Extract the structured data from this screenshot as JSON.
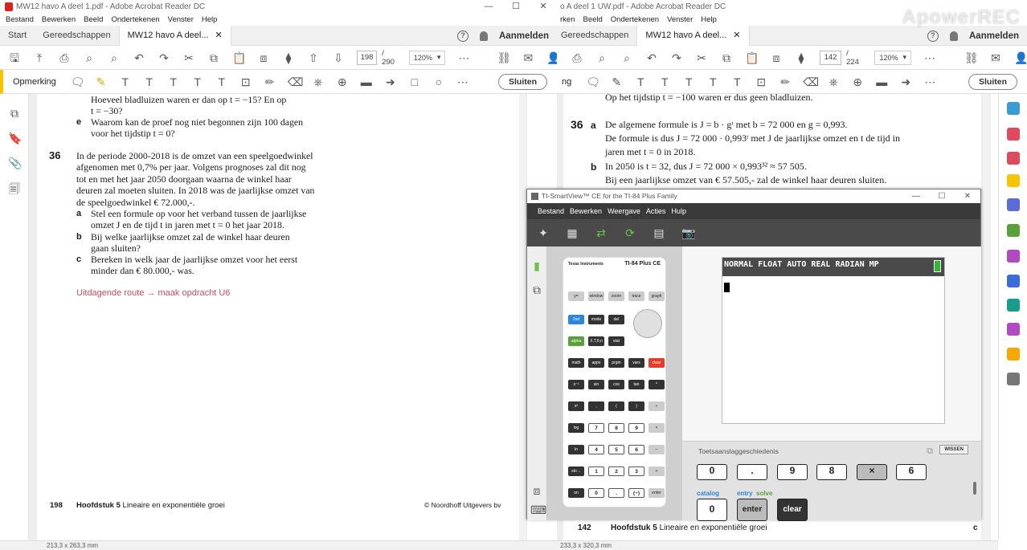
{
  "left_window": {
    "title": "MW12 havo A deel 1.pdf - Adobe Acrobat Reader DC",
    "menu": [
      "Bestand",
      "Bewerken",
      "Beeld",
      "Ondertekenen",
      "Venster",
      "Help"
    ],
    "tabs": {
      "start": "Start",
      "tools": "Gereedschappen",
      "doc": "MW12 havo A deel..."
    },
    "signin": "Aanmelden",
    "page_current": "198",
    "page_total": "/ 290",
    "zoom": "120%",
    "annotation_label": "Opmerking",
    "close_label": "Sluiten",
    "status": "213,3 x 263,3 mm",
    "page": {
      "lines_top": [
        "Hoeveel bladluizen waren er dan op t = −15? En op",
        "t = −30?"
      ],
      "e_label": "e",
      "e_lines": [
        "Waarom kan de proef nog niet begonnen zijn 100 dagen",
        "voor het tijdstip t = 0?"
      ],
      "q_number": "36",
      "q_lines": [
        "In de periode 2000-2018 is de omzet van een speelgoedwinkel",
        "afgenomen met 0,7% per jaar. Volgens prognoses zal dit nog",
        "tot en met het jaar 2050 doorgaan waarna de winkel haar",
        "deuren zal moeten sluiten. In 2018 was de jaarlijkse omzet van",
        "de speelgoedwinkel € 72.000,-."
      ],
      "a_label": "a",
      "a_lines": [
        "Stel een formule op voor het verband tussen de jaarlijkse",
        "omzet J en de tijd t in jaren met t = 0 het jaar 2018."
      ],
      "b_label": "b",
      "b_lines": [
        "Bij welke jaarlijkse omzet zal de winkel haar deuren",
        "gaan sluiten?"
      ],
      "c_label": "c",
      "c_lines": [
        "Bereken in welk jaar de jaarlijkse omzet voor het eerst",
        "minder dan € 80.000,- was."
      ],
      "route": "Uitdagende route → maak opdracht U6",
      "footer_page": "198",
      "footer_chapter_bold": "Hoofdstuk 5",
      "footer_chapter": "Lineaire en exponentiële groei",
      "footer_publisher": "© Noordhoff Uitgevers bv"
    }
  },
  "right_window": {
    "title": "o A deel 1 UW.pdf - Adobe Acrobat Reader DC",
    "menu": [
      "rken",
      "Beeld",
      "Ondertekenen",
      "Venster",
      "Help"
    ],
    "tab_tools": "Gereedschappen",
    "tab_doc": "MW12 havo A deel...",
    "signin": "Aanmelden",
    "page_current": "142",
    "page_total": "/ 224",
    "zoom": "120%",
    "annotation_label": "ng",
    "close_label": "Sluiten",
    "status": "233,3 x 320,3 mm",
    "page": {
      "top_line": "Op het tijdstip t = −100 waren er dus geen bladluizen.",
      "q_number": "36",
      "a_label": "a",
      "a_lines": [
        "De algemene formule is J = b · gᵗ met b = 72 000 en g = 0,993.",
        "De formule is dus J = 72 000 · 0,993ᵗ met J de jaarlijkse omzet en t de tijd in",
        "jaren met t = 0 in 2018."
      ],
      "b_label": "b",
      "b_lines": [
        "In 2050 is t = 32, dus J = 72 000 × 0,993³² ≈ 57 505.",
        "Bij een jaarlijkse omzet van € 57.505,- zal de winkel haar deuren sluiten."
      ],
      "footer_page": "142",
      "footer_chapter_bold": "Hoofdstuk 5",
      "footer_chapter": "Lineaire en exponentiële groei",
      "footer_right": "c"
    }
  },
  "ti_window": {
    "title": "TI-SmartView™ CE for the TI-84 Plus Family",
    "menu": [
      "Bestand",
      "Bewerken",
      "Weergave",
      "Acties",
      "Hulp"
    ],
    "calc_brand": "Texas Instruments",
    "calc_model": "TI-84 Plus CE",
    "lcd_status": "NORMAL FLOAT AUTO REAL RADIAN MP",
    "history_title": "Toetsaanslaggeschiedenis",
    "history_clear": "WISSEN",
    "history_row1": [
      "0",
      ".",
      "9",
      "8",
      "×",
      "6"
    ],
    "catalog_label": "catalog",
    "entry_label": "entry",
    "solve_label": "solve",
    "history_row2": [
      "0",
      "enter",
      "clear"
    ],
    "keys": {
      "row1": [
        "y=",
        "window",
        "zoom",
        "trace",
        "graph"
      ],
      "row2": [
        "2nd",
        "mode",
        "del"
      ],
      "row3": [
        "alpha",
        "X,T,θ,n",
        "stat"
      ],
      "row4": [
        "math",
        "apps",
        "prgm",
        "vars",
        "clear"
      ],
      "row5": [
        "x⁻¹",
        "sin",
        "cos",
        "tan",
        "^"
      ],
      "row6": [
        "x²",
        ",",
        "(",
        ")",
        "÷"
      ],
      "row7": [
        "log",
        "7",
        "8",
        "9",
        "×"
      ],
      "row8": [
        "ln",
        "4",
        "5",
        "6",
        "−"
      ],
      "row9": [
        "sto→",
        "1",
        "2",
        "3",
        "+"
      ],
      "row10": [
        "on",
        "0",
        ".",
        "(−)",
        "enter"
      ]
    }
  },
  "watermark": "ApowerREC"
}
